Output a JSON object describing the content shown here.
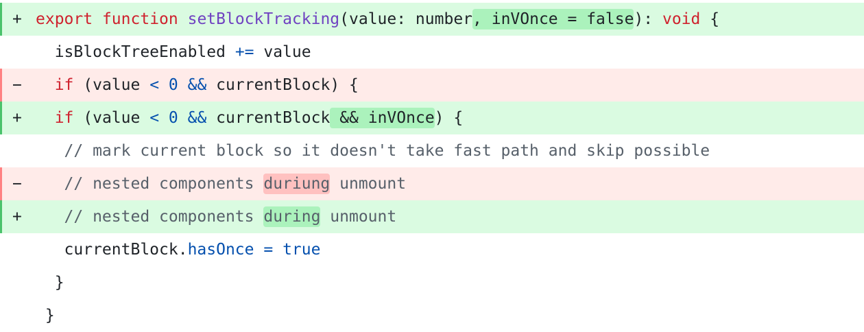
{
  "diff": {
    "lines": [
      {
        "type": "add",
        "marker": "+",
        "indent": "",
        "tokens": [
          {
            "text": "export",
            "cls": "tok-kw"
          },
          {
            "text": " ",
            "cls": ""
          },
          {
            "text": "function",
            "cls": "tok-kw"
          },
          {
            "text": " ",
            "cls": ""
          },
          {
            "text": "setBlockTracking",
            "cls": "tok-fn"
          },
          {
            "text": "(value: number",
            "cls": ""
          },
          {
            "text": ", inVOnce = false",
            "cls": "",
            "hl": "add"
          },
          {
            "text": "): ",
            "cls": ""
          },
          {
            "text": "void",
            "cls": "tok-kw"
          },
          {
            "text": " {",
            "cls": ""
          }
        ]
      },
      {
        "type": "ctx",
        "marker": "",
        "indent": "  ",
        "tokens": [
          {
            "text": "isBlockTreeEnabled ",
            "cls": ""
          },
          {
            "text": "+=",
            "cls": "tok-op"
          },
          {
            "text": " value",
            "cls": ""
          }
        ]
      },
      {
        "type": "del",
        "marker": "−",
        "indent": "  ",
        "tokens": [
          {
            "text": "if",
            "cls": "tok-kw"
          },
          {
            "text": " (value ",
            "cls": ""
          },
          {
            "text": "<",
            "cls": "tok-op"
          },
          {
            "text": " ",
            "cls": ""
          },
          {
            "text": "0",
            "cls": "tok-num"
          },
          {
            "text": " ",
            "cls": ""
          },
          {
            "text": "&&",
            "cls": "tok-op"
          },
          {
            "text": " currentBlock) {",
            "cls": ""
          }
        ]
      },
      {
        "type": "add",
        "marker": "+",
        "indent": "  ",
        "tokens": [
          {
            "text": "if",
            "cls": "tok-kw"
          },
          {
            "text": " (value ",
            "cls": ""
          },
          {
            "text": "<",
            "cls": "tok-op"
          },
          {
            "text": " ",
            "cls": ""
          },
          {
            "text": "0",
            "cls": "tok-num"
          },
          {
            "text": " ",
            "cls": ""
          },
          {
            "text": "&&",
            "cls": "tok-op"
          },
          {
            "text": " currentBlock",
            "cls": ""
          },
          {
            "text": " && inVOnce",
            "cls": "",
            "hl": "add"
          },
          {
            "text": ") {",
            "cls": ""
          }
        ]
      },
      {
        "type": "ctx",
        "marker": "",
        "indent": "   ",
        "tokens": [
          {
            "text": "// mark current block so it doesn't take fast path and skip possible",
            "cls": "tok-comment"
          }
        ]
      },
      {
        "type": "del",
        "marker": "−",
        "indent": "   ",
        "tokens": [
          {
            "text": "// nested components ",
            "cls": "tok-comment"
          },
          {
            "text": "duriung",
            "cls": "tok-comment",
            "hl": "del"
          },
          {
            "text": " unmount",
            "cls": "tok-comment"
          }
        ]
      },
      {
        "type": "add",
        "marker": "+",
        "indent": "   ",
        "tokens": [
          {
            "text": "// nested components ",
            "cls": "tok-comment"
          },
          {
            "text": "during",
            "cls": "tok-comment",
            "hl": "add"
          },
          {
            "text": " unmount",
            "cls": "tok-comment"
          }
        ]
      },
      {
        "type": "ctx",
        "marker": "",
        "indent": "   ",
        "tokens": [
          {
            "text": "currentBlock.",
            "cls": ""
          },
          {
            "text": "hasOnce",
            "cls": "tok-prop"
          },
          {
            "text": " ",
            "cls": ""
          },
          {
            "text": "=",
            "cls": "tok-op"
          },
          {
            "text": " ",
            "cls": ""
          },
          {
            "text": "true",
            "cls": "tok-bool"
          }
        ]
      },
      {
        "type": "ctx",
        "marker": "",
        "indent": "  ",
        "tokens": [
          {
            "text": "}",
            "cls": ""
          }
        ]
      },
      {
        "type": "ctx",
        "marker": "",
        "indent": " ",
        "tokens": [
          {
            "text": "}",
            "cls": ""
          }
        ]
      }
    ]
  },
  "colors": {
    "add_bg": "#dafbe1",
    "add_highlight": "#abf2bc",
    "del_bg": "#ffebe9",
    "del_highlight": "#ffc1c0",
    "keyword": "#cf222e",
    "function": "#6f42c1",
    "operator": "#0550ae",
    "comment": "#57606a"
  }
}
